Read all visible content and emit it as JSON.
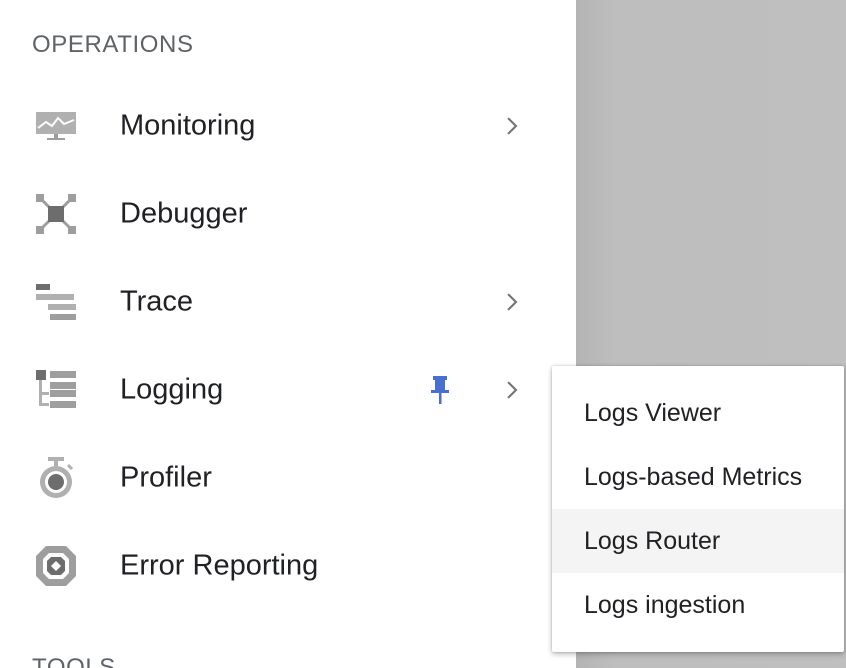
{
  "nav": {
    "section_header": "OPERATIONS",
    "next_section_header": "TOOLS",
    "items": [
      {
        "label": "Monitoring",
        "icon": "monitoring-icon",
        "has_submenu": true
      },
      {
        "label": "Debugger",
        "icon": "debugger-icon",
        "has_submenu": false
      },
      {
        "label": "Trace",
        "icon": "trace-icon",
        "has_submenu": true
      },
      {
        "label": "Logging",
        "icon": "logging-icon",
        "has_submenu": true,
        "pinned": true
      },
      {
        "label": "Profiler",
        "icon": "profiler-icon",
        "has_submenu": false
      },
      {
        "label": "Error Reporting",
        "icon": "error-reporting-icon",
        "has_submenu": false
      }
    ]
  },
  "submenu": {
    "parent": "Logging",
    "items": [
      {
        "label": "Logs Viewer"
      },
      {
        "label": "Logs-based Metrics"
      },
      {
        "label": "Logs Router",
        "hovered": true
      },
      {
        "label": "Logs ingestion"
      }
    ]
  },
  "colors": {
    "icon_gray": "#9e9e9e",
    "icon_dark": "#757575",
    "pin_blue": "#4a6fd3",
    "text": "#202124",
    "header_text": "#5f6368",
    "overlay": "#bfbfbf",
    "hover_bg": "#f4f4f4"
  }
}
